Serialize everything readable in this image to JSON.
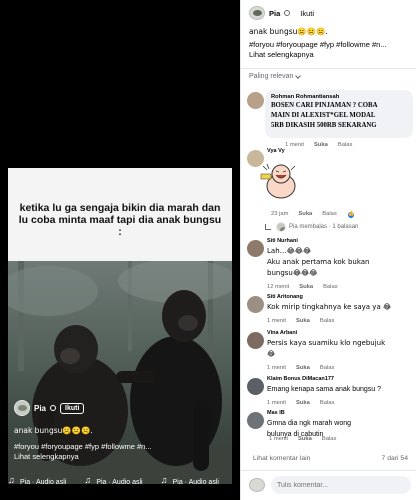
{
  "video": {
    "overlay_caption": "ketika lu ga sengaja bikin dia marah dan lu coba minta maaf tapi dia anak bungsu :",
    "author": "Pia",
    "follow_label": "Ikuti",
    "description_line1": "anak bungsu☹️☹️☹️.",
    "hashtags": "#foryou #foryoupage #fyp #followme #n... ",
    "see_more": "Lihat selengkapnya",
    "audio": [
      "Pia · Audio asli",
      "Pia · Audio asli",
      "Pia · Audio asli"
    ]
  },
  "post": {
    "author": "Pia",
    "follow_label": "Ikuti",
    "description_line1": "anak bungsu☹️☹️☹️.",
    "hashtags": "#foryou #foryoupage #fyp #followme #n... ",
    "see_more": "Lihat selengkapnya",
    "sort_label": "Paling relevan"
  },
  "comments": [
    {
      "name": "Rohman Rohmantiansah",
      "text_lines": [
        "BOSEN CARI PINJAMAN ? COBA",
        "MAIN DI ALEXIST*GEL MODAL",
        "5RB DIKASIH 500RB SEKARANG"
      ],
      "time": "1 menit",
      "like": "Suka",
      "reply": "Balas"
    },
    {
      "name": "Vya Vy",
      "sticker": "laughing-sticker",
      "time": "23 jam",
      "like": "Suka",
      "reply": "Balas",
      "reply_summary": "Pia membalas · 1 balasan"
    },
    {
      "name": "Siti Nurhani",
      "text_lines": [
        "Lah…😂😂😂",
        "Aku anak pertama kok bukan",
        "bungsu😂😂😂"
      ],
      "time": "12 menit",
      "like": "Suka",
      "reply": "Balas"
    },
    {
      "name": "Siti Aritonang",
      "text_lines": [
        "Kok mirip tingkahnya ke saya ya 😂"
      ],
      "time": "1 menit",
      "like": "Suka",
      "reply": "Balas"
    },
    {
      "name": "Vina Arbani",
      "text_lines": [
        "Persis kaya suamiku klo ngebujuk",
        "😂"
      ],
      "time": "1 menit",
      "like": "Suka",
      "reply": "Balas"
    },
    {
      "name": "Klaim Bonus DiMacan177",
      "text_lines": [
        "Emang kenapa sama anak bungsu ?"
      ],
      "time": "1 menit",
      "like": "Suka",
      "reply": "Balas"
    },
    {
      "name": "Mas IB",
      "text_lines": [
        "Gmna dia ngk marah wong",
        "bulunya di cabutin"
      ],
      "time": "1 menit",
      "like": "Suka",
      "reply": "Balas"
    }
  ],
  "footer": {
    "more_comments": "Lihat komentar lain",
    "count": "7 dari 54",
    "composer_placeholder": "Tulis komentar..."
  },
  "colors": {
    "link": "#65676b",
    "like_blue": "#1877f2",
    "bg_comment": "#f0f2f5"
  }
}
